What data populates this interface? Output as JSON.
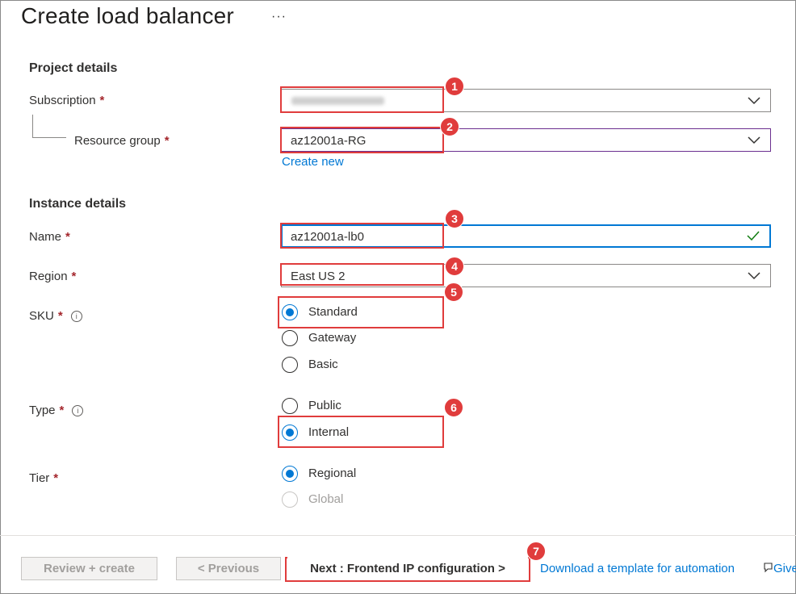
{
  "header": {
    "title": "Create load balancer",
    "more": "···"
  },
  "project": {
    "heading": "Project details",
    "subscription": {
      "label": "Subscription",
      "required": "*"
    },
    "resource_group": {
      "label": "Resource group",
      "required": "*",
      "value": "az12001a-RG",
      "create_new": "Create new"
    }
  },
  "instance": {
    "heading": "Instance details",
    "name": {
      "label": "Name",
      "required": "*",
      "value": "az12001a-lb0"
    },
    "region": {
      "label": "Region",
      "required": "*",
      "value": "East US 2"
    },
    "sku": {
      "label": "SKU",
      "required": "*",
      "info": "i",
      "options": [
        "Standard",
        "Gateway",
        "Basic"
      ],
      "selected": "Standard"
    },
    "type": {
      "label": "Type",
      "required": "*",
      "info": "i",
      "options": [
        "Public",
        "Internal"
      ],
      "selected": "Internal"
    },
    "tier": {
      "label": "Tier",
      "required": "*",
      "options": [
        "Regional",
        "Global"
      ],
      "selected": "Regional",
      "disabled": [
        "Global"
      ]
    }
  },
  "badges": [
    "1",
    "2",
    "3",
    "4",
    "5",
    "6",
    "7"
  ],
  "footer": {
    "review_create": "Review + create",
    "previous": "< Previous",
    "next": "Next : Frontend IP configuration >",
    "download_template": "Download a template for automation",
    "feedback": "Give"
  },
  "colors": {
    "accent": "#0078d4",
    "highlight": "#e03c3c",
    "required": "#a4262c",
    "valid": "#107c10",
    "focus": "#6b2f8f"
  }
}
